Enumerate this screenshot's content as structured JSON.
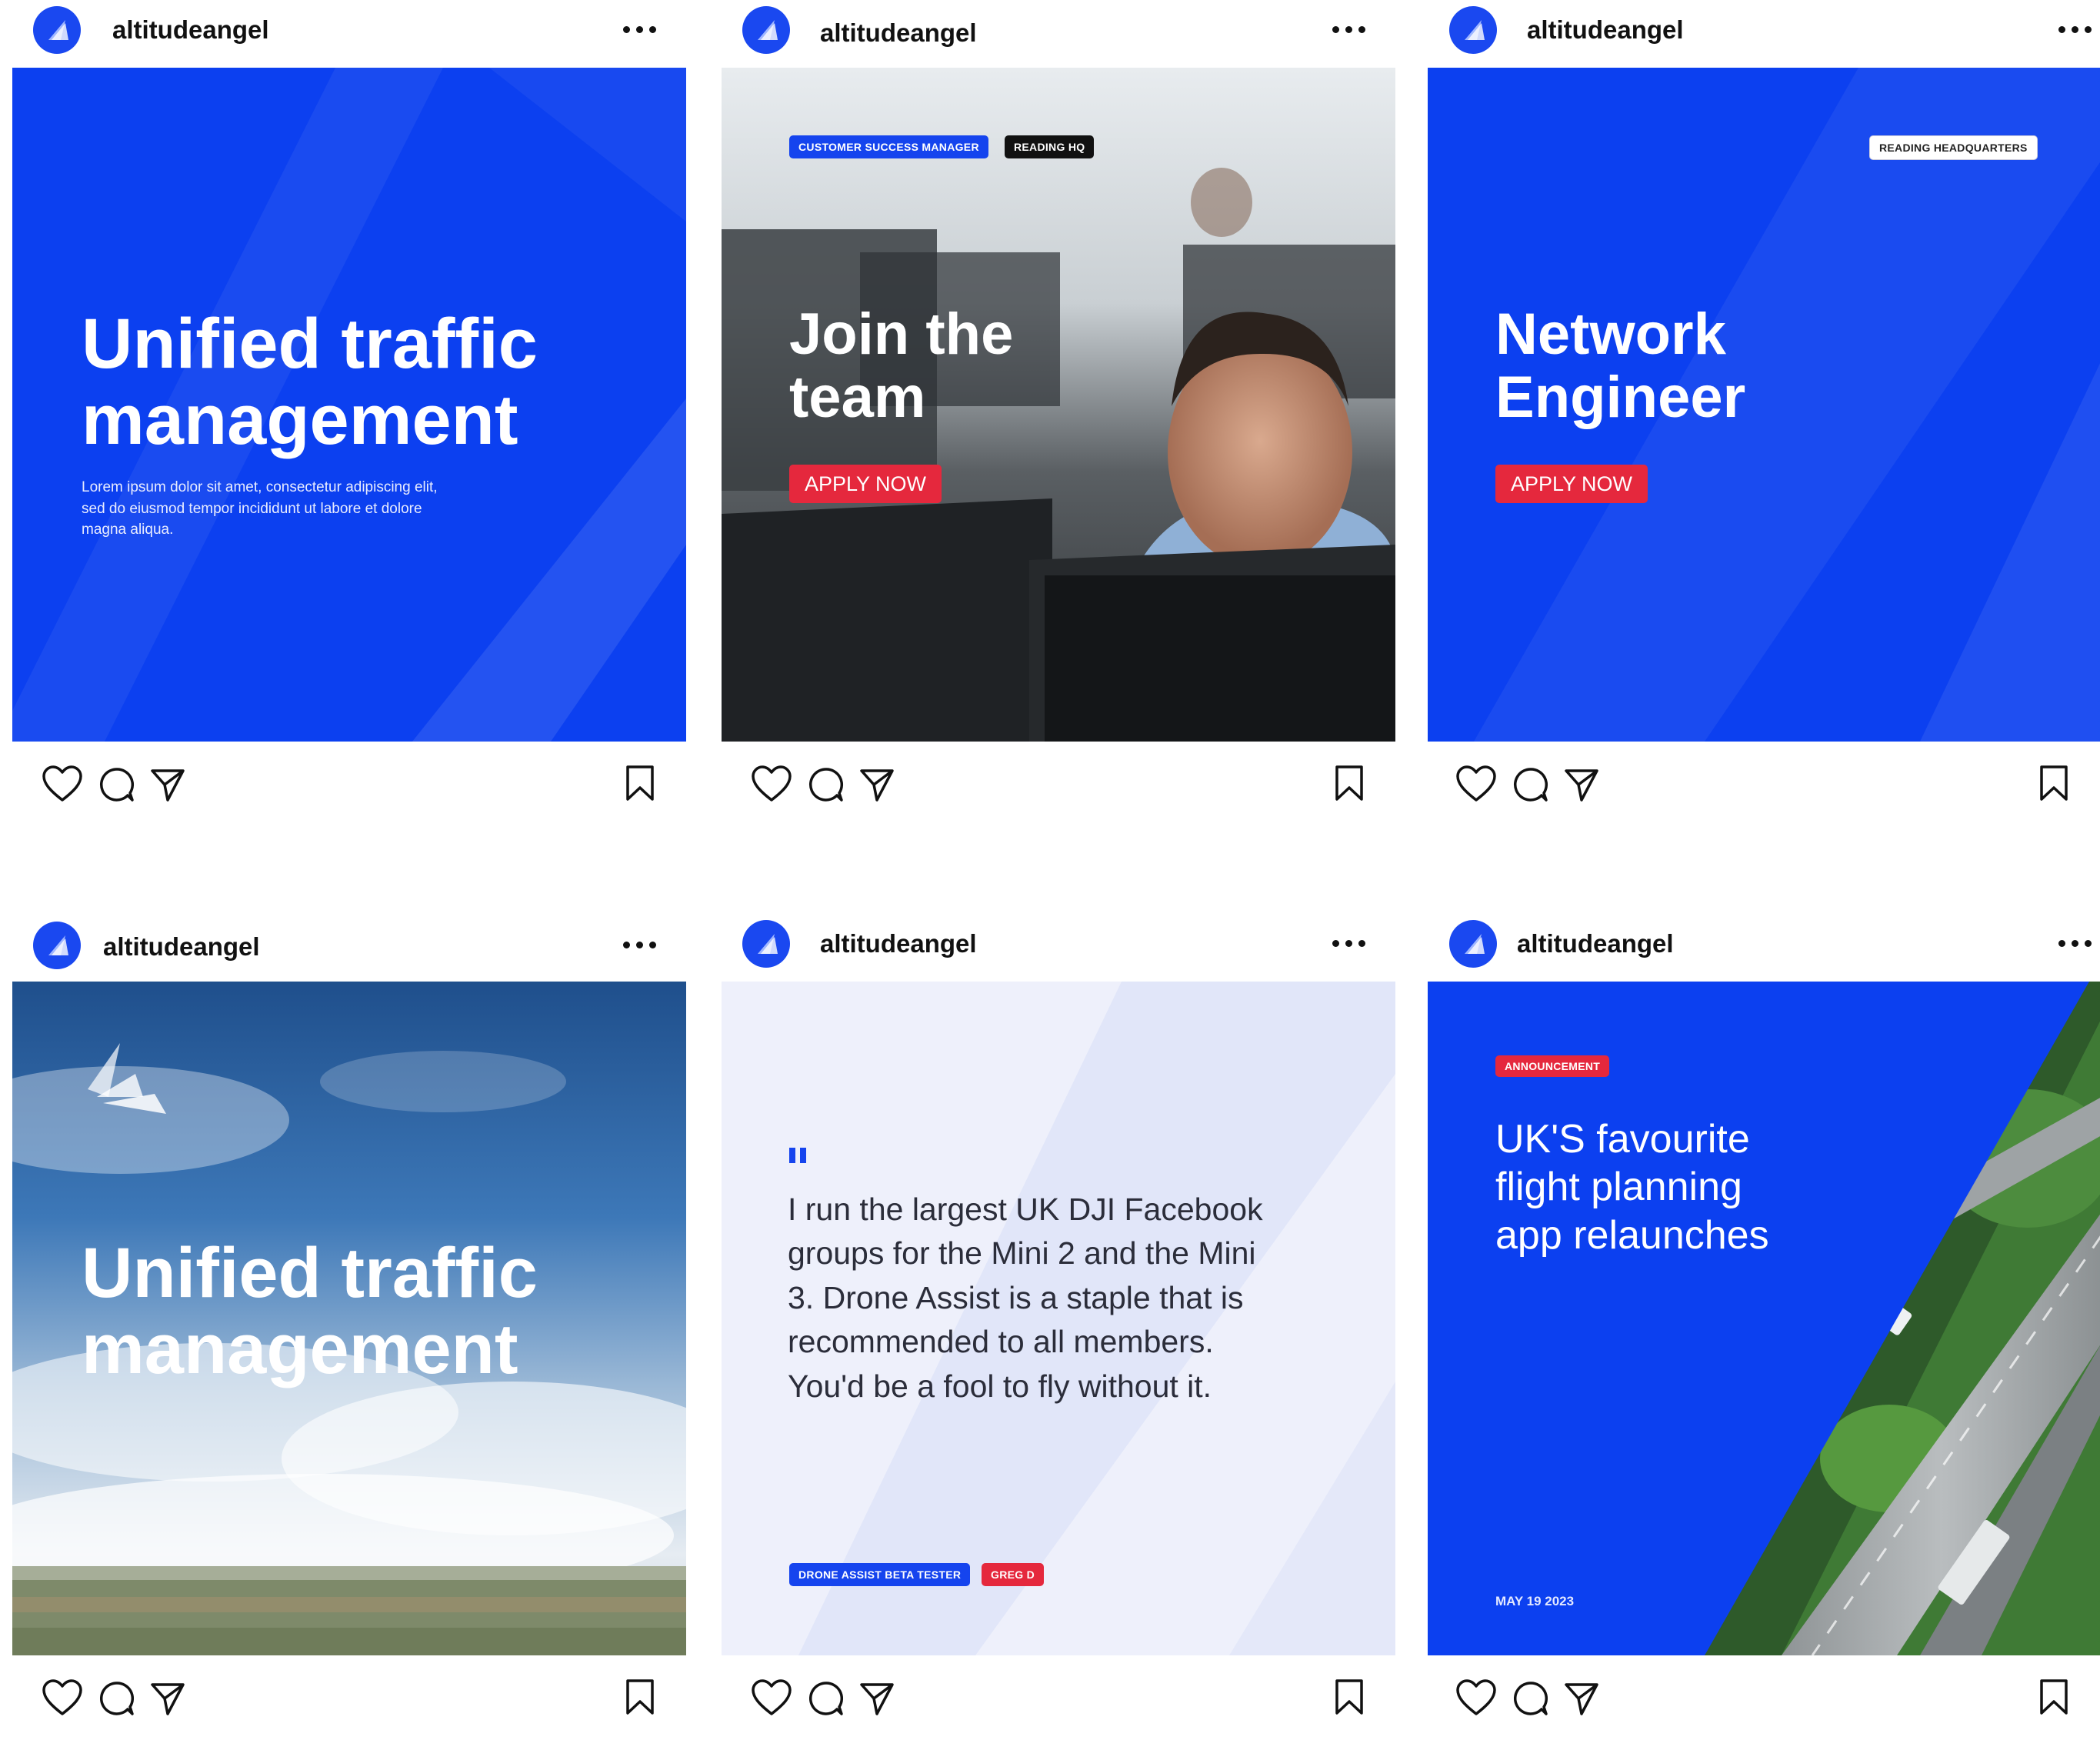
{
  "account": {
    "username": "altitudeangel"
  },
  "colors": {
    "brand_blue": "#0c40f0",
    "brand_red": "#e5283d",
    "quote_bg": "#eef0fb"
  },
  "icons": [
    "heart-icon",
    "comment-icon",
    "share-icon",
    "bookmark-icon",
    "more-icon",
    "quote-mark-icon"
  ],
  "posts": [
    {
      "username": "altitudeangel",
      "title_line1": "Unified traffic",
      "title_line2": "management",
      "body": "Lorem ipsum dolor sit amet, consectetur adipiscing elit, sed do eiusmod tempor incididunt ut labore et dolore magna aliqua."
    },
    {
      "username": "altitudeangel",
      "tag1": "CUSTOMER SUCCESS MANAGER",
      "tag2": "READING HQ",
      "title_line1": "Join the",
      "title_line2": "team",
      "cta": "APPLY NOW"
    },
    {
      "username": "altitudeangel",
      "tag1": "READING HEADQUARTERS",
      "title_line1": "Network",
      "title_line2": "Engineer",
      "cta": "APPLY NOW"
    },
    {
      "username": "altitudeangel",
      "title_line1": "Unified traffic",
      "title_line2": "management"
    },
    {
      "username": "altitudeangel",
      "quote_mark": "\"",
      "quote_lines": [
        "I run the largest UK DJI Facebook",
        "groups for the Mini 2 and the Mini",
        "3. Drone Assist is a staple that is",
        "recommended to all members.",
        "You'd be a fool to fly without it."
      ],
      "tag1": "DRONE ASSIST BETA TESTER",
      "tag2": "GREG D"
    },
    {
      "username": "altitudeangel",
      "tag1": "ANNOUNCEMENT",
      "title_lines": [
        "UK'S favourite",
        "flight planning",
        "app relaunches"
      ],
      "date": "MAY 19 2023"
    }
  ]
}
